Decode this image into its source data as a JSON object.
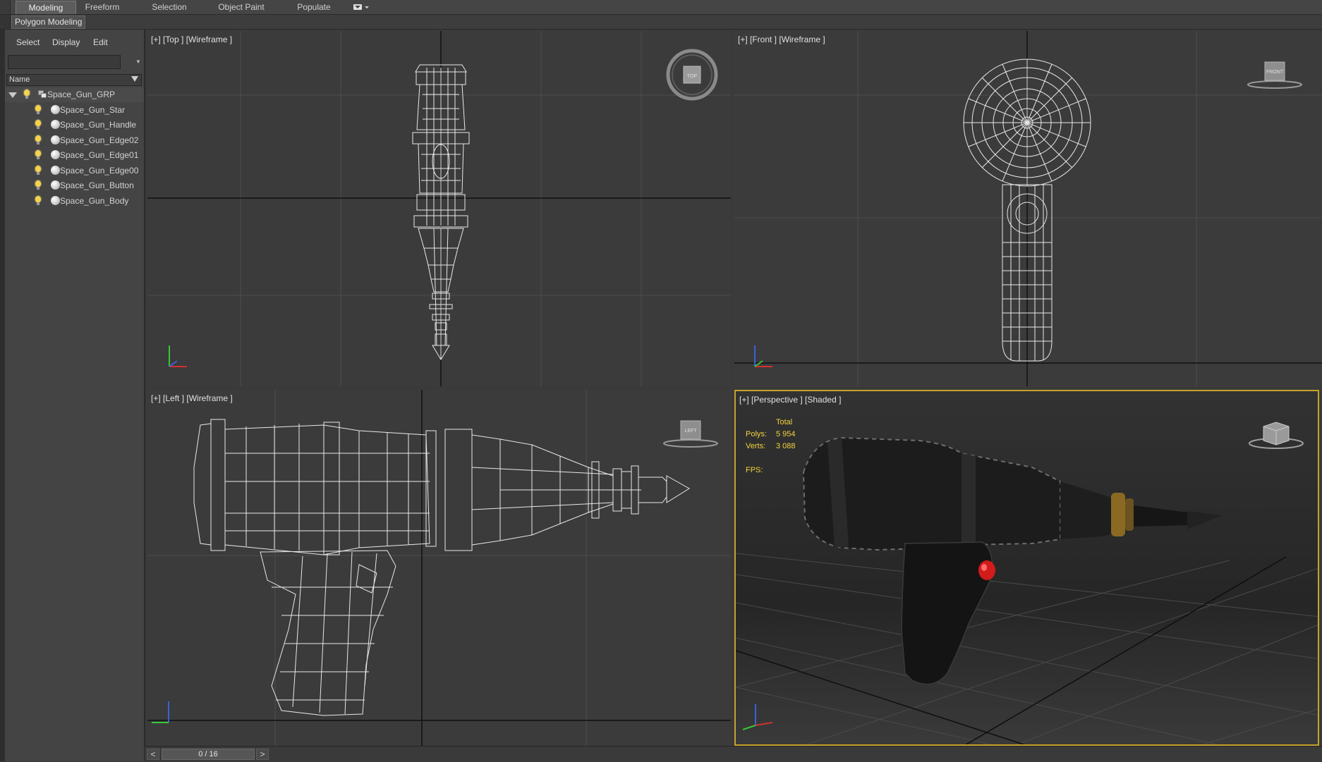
{
  "ribbon": {
    "tabs": [
      {
        "label": "Modeling",
        "active": true
      },
      {
        "label": "Freeform",
        "active": false
      },
      {
        "label": "Selection",
        "active": false
      },
      {
        "label": "Object Paint",
        "active": false
      },
      {
        "label": "Populate",
        "active": false
      }
    ],
    "options_icon": "ribbon-options-icon",
    "subtab": "Polygon Modeling"
  },
  "explorer": {
    "menu": [
      "Select",
      "Display",
      "Edit"
    ],
    "search_value": "",
    "column_header": "Name",
    "group": {
      "label": "Space_Gun_GRP",
      "expanded": true
    },
    "items": [
      {
        "label": "Space_Gun_Star"
      },
      {
        "label": "Space_Gun_Handle"
      },
      {
        "label": "Space_Gun_Edge02"
      },
      {
        "label": "Space_Gun_Edge01"
      },
      {
        "label": "Space_Gun_Edge00"
      },
      {
        "label": "Space_Gun_Button"
      },
      {
        "label": "Space_Gun_Body"
      }
    ]
  },
  "viewports": {
    "top": {
      "label": "[+] [Top ] [Wireframe ]",
      "cube_text": "TOP"
    },
    "front": {
      "label": "[+] [Front ] [Wireframe ]",
      "cube_text": "FRONT"
    },
    "left": {
      "label": "[+] [Left ] [Wireframe ]",
      "cube_text": "LEFT"
    },
    "perspective": {
      "label": "[+] [Perspective ] [Shaded ]",
      "stats": {
        "total_label": "Total",
        "polys_label": "Polys:",
        "polys_value": "5 954",
        "verts_label": "Verts:",
        "verts_value": "3 088",
        "fps_label": "FPS:"
      }
    }
  },
  "timeline": {
    "prev": "<",
    "next": ">",
    "frame": "0 / 16",
    "current_frame": 0,
    "total_frames": 16
  },
  "colors": {
    "active_border": "#c6a12c",
    "stats_text": "#f2d33d",
    "wireframe": "#e8e8e8",
    "button_red": "#d21b1b",
    "brass_ring": "#8a6a22"
  }
}
